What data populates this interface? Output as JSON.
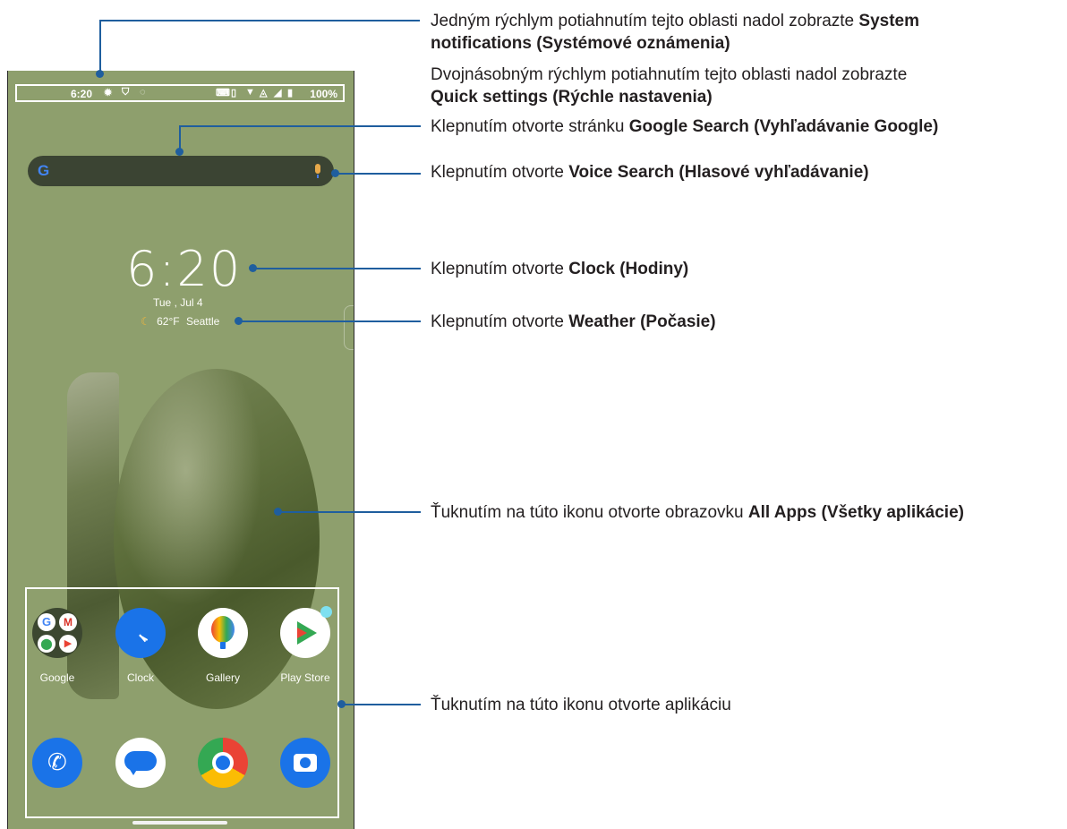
{
  "statusbar": {
    "time": "6:20",
    "battery": "100%",
    "left_icons": [
      "settings-icon",
      "shield-icon",
      "data-saver-icon"
    ],
    "right_icons": [
      "keyboard-icon",
      "vibrate-icon",
      "wifi-icon",
      "hotspot-icon",
      "signal-icon",
      "battery-icon"
    ]
  },
  "search": {
    "logo": "G",
    "icons": [
      "google-logo-icon",
      "mic-icon"
    ]
  },
  "clock": {
    "time": "6:20",
    "date": "Tue , Jul 4"
  },
  "weather": {
    "temp": "62°F",
    "city": "Seattle"
  },
  "apps_row1": [
    {
      "label": "Google",
      "icon": "google-folder-icon"
    },
    {
      "label": "Clock",
      "icon": "clock-icon"
    },
    {
      "label": "Gallery",
      "icon": "gallery-icon"
    },
    {
      "label": "Play Store",
      "icon": "play-store-icon"
    }
  ],
  "apps_row2": [
    {
      "icon": "phone-icon"
    },
    {
      "icon": "messages-icon"
    },
    {
      "icon": "chrome-icon"
    },
    {
      "icon": "camera-icon"
    }
  ],
  "callouts": {
    "notif_prefix": "Jedným rýchlym potiahnutím tejto oblasti nadol zobrazte ",
    "notif_bold_1": "System",
    "notif_bold_2": "notifications (Systémové oznámenia)",
    "quick_prefix": "Dvojnásobným rýchlym potiahnutím tejto oblasti nadol zobrazte",
    "quick_bold": "Quick settings (Rýchle nastavenia)",
    "search_prefix": "Klepnutím otvorte stránku ",
    "search_bold": "Google Search (Vyhľadávanie Google)",
    "voice_prefix": "Klepnutím otvorte ",
    "voice_bold": "Voice Search (Hlasové vyhľadávanie)",
    "clock_prefix": "Klepnutím otvorte ",
    "clock_bold": "Clock (Hodiny)",
    "weather_prefix": "Klepnutím otvorte ",
    "weather_bold": "Weather (Počasie)",
    "allapps_prefix": "Ťuknutím na túto ikonu otvorte obrazovku ",
    "allapps_bold": "All Apps (Všetky aplikácie)",
    "app_text": "Ťuknutím na túto ikonu otvorte aplikáciu"
  },
  "colors": {
    "wallpaper": "#8e9f6d",
    "callout_line": "#1f5e9e"
  }
}
